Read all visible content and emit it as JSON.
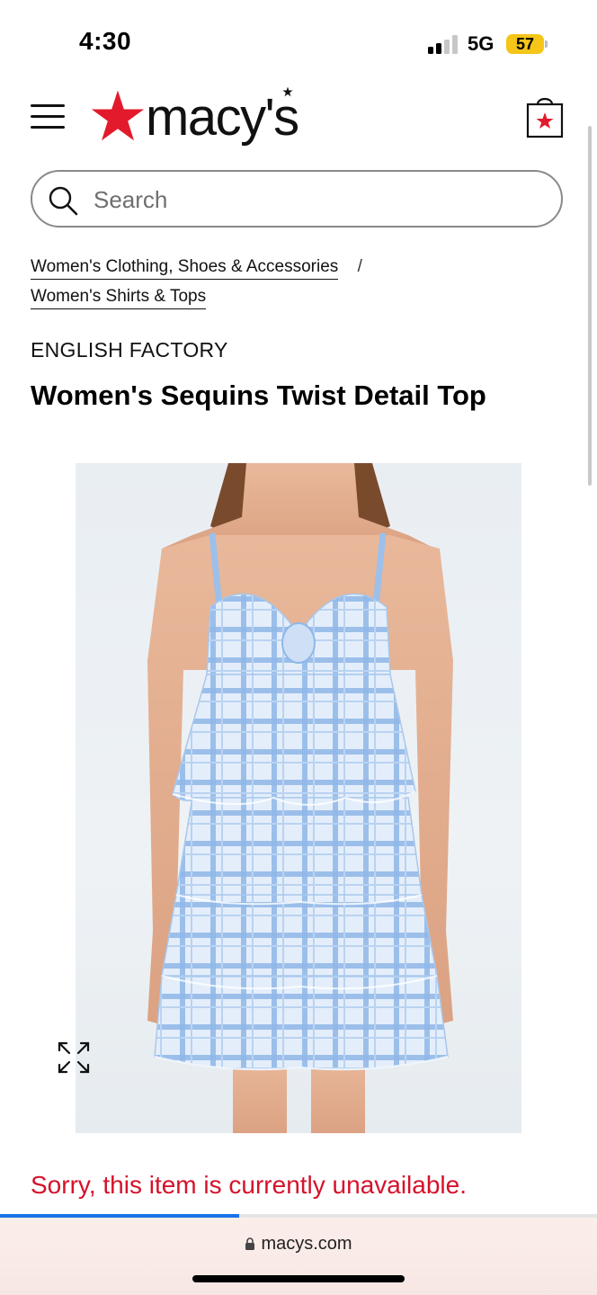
{
  "status_bar": {
    "time": "4:30",
    "network": "5G",
    "battery": "57",
    "battery_color": "#f5c518"
  },
  "header": {
    "menu_icon": "hamburger-menu-icon",
    "logo_text": "macy's",
    "logo_star_color": "#e21a2c",
    "bag_icon": "shopping-bag-icon"
  },
  "search": {
    "placeholder": "Search",
    "icon": "search-icon"
  },
  "breadcrumb": {
    "items": [
      "Women's Clothing, Shoes & Accessories",
      "Women's Shirts & Tops"
    ],
    "separator": "/"
  },
  "product": {
    "brand": "ENGLISH FACTORY",
    "title": "Women's Sequins Twist Detail Top",
    "image_alt": "Model wearing blue plaid ruffled camisole top and tiered skirt",
    "expand_icon": "expand-arrows-icon",
    "availability_message": "Sorry, this item is currently unavailable.",
    "availability_color": "#d5122b"
  },
  "browser": {
    "url": "macys.com",
    "load_progress": 0.4,
    "progress_color": "#1a73e8"
  }
}
